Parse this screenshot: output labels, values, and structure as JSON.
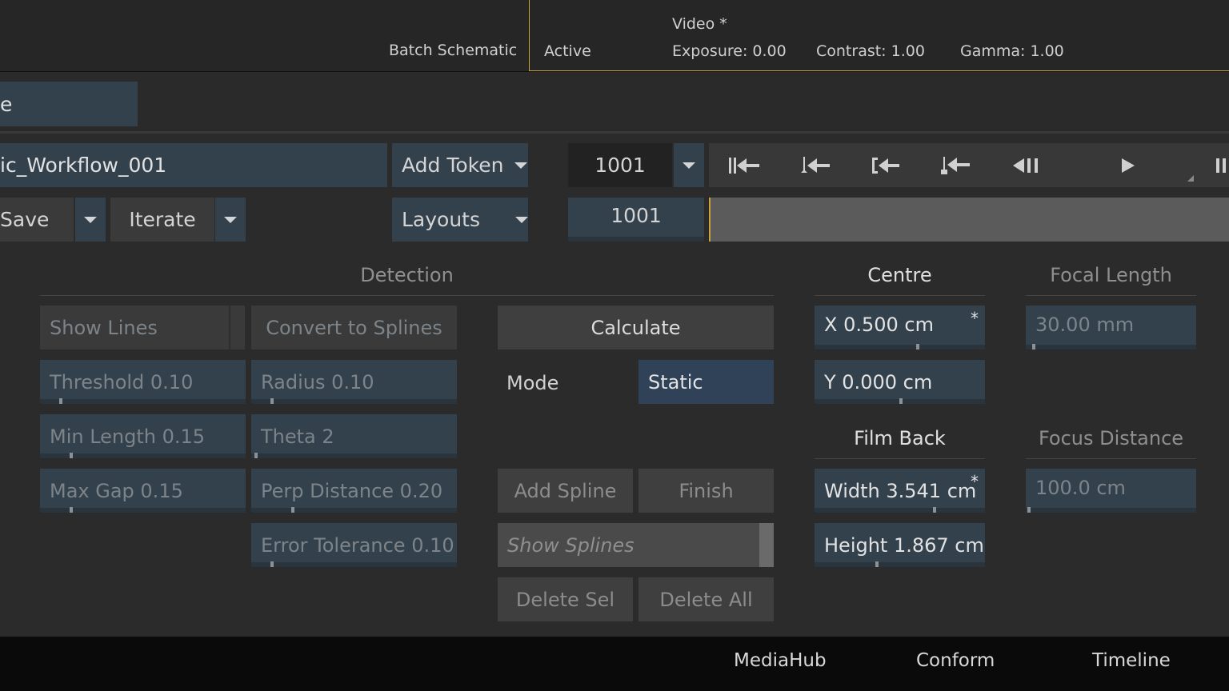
{
  "topbar": {
    "batch_schematic": "Batch Schematic",
    "active": "Active",
    "video": "Video *",
    "exposure": "Exposure: 0.00",
    "contrast": "Contrast: 1.00",
    "gamma": "Gamma: 1.00"
  },
  "header": {
    "name_fragment": "e",
    "filename": "ic_Workflow_001",
    "add_token": "Add Token",
    "save": "Save",
    "iterate": "Iterate",
    "layouts": "Layouts",
    "frame_field": "1001",
    "current_frame": "1001"
  },
  "transport": {
    "icons": [
      "go-to-start-icon",
      "previous-keyframe-icon",
      "go-to-in-icon",
      "previous-mark-icon",
      "step-back-icon",
      "play-icon",
      "pause-icon"
    ]
  },
  "detection": {
    "title": "Detection",
    "show_lines": "Show Lines",
    "convert_to_splines": "Convert to Splines",
    "threshold": "Threshold 0.10",
    "radius": "Radius 0.10",
    "min_length": "Min Length 0.15",
    "theta": "Theta 2",
    "max_gap": "Max Gap 0.15",
    "perp_distance": "Perp Distance 0.20",
    "error_tolerance": "Error Tolerance 0.10"
  },
  "actions": {
    "calculate": "Calculate",
    "mode_label": "Mode",
    "mode_value": "Static",
    "add_spline": "Add Spline",
    "finish": "Finish",
    "show_splines": "Show Splines",
    "delete_sel": "Delete Sel",
    "delete_all": "Delete All"
  },
  "centre": {
    "title": "Centre",
    "x": "X 0.500 cm",
    "x_modified": "*",
    "y": "Y 0.000 cm"
  },
  "film_back": {
    "title": "Film Back",
    "width": "Width 3.541 cm",
    "width_modified": "*",
    "height": "Height 1.867 cm"
  },
  "focal_length": {
    "title": "Focal Length",
    "value": "30.00 mm"
  },
  "focus_distance": {
    "title": "Focus Distance",
    "value": "100.0 cm"
  },
  "footer": {
    "mediahub": "MediaHub",
    "conform": "Conform",
    "timeline": "Timeline"
  },
  "colors": {
    "accent_yellow": "#c8a23a",
    "field_blue": "#33414d",
    "background": "#2b2b2b"
  }
}
